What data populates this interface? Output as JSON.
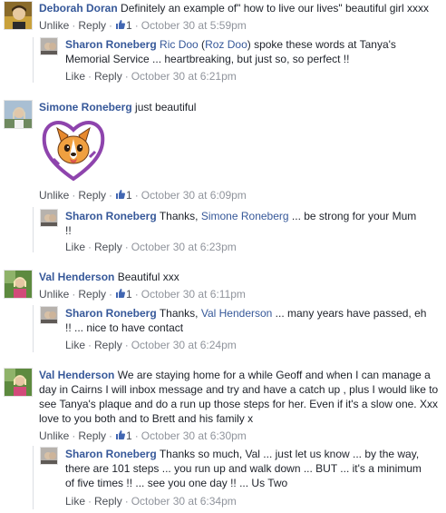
{
  "colors": {
    "link": "#365899",
    "meta": "#90949c",
    "text": "#1d2129",
    "action": "#4b4f56"
  },
  "comments": [
    {
      "author": "Deborah Doran",
      "text": "Definitely an example of\" how to live our lives\" beautiful girl xxxx",
      "unlike": "Unlike",
      "reply": "Reply",
      "likes": "1",
      "time": "October 30 at 5:59pm",
      "reply_item": {
        "author": "Sharon Roneberg",
        "mention1": "Ric Doo",
        "paren_open": " (",
        "mention2": "Roz Doo",
        "text": ") spoke these words at Tanya's Memorial Service ... heartbreaking, but just so, so perfect !!",
        "like": "Like",
        "reply": "Reply",
        "time": "October 30 at 6:21pm"
      }
    },
    {
      "author": "Simone Roneberg",
      "text": "just beautiful",
      "sticker": "corgi-heart-sticker",
      "unlike": "Unlike",
      "reply": "Reply",
      "likes": "1",
      "time": "October 30 at 6:09pm",
      "reply_item": {
        "author": "Sharon Roneberg",
        "pre": "Thanks, ",
        "mention": "Simone Roneberg",
        "text": " ... be strong for your Mum !!",
        "like": "Like",
        "reply": "Reply",
        "time": "October 30 at 6:23pm"
      }
    },
    {
      "author": "Val Henderson",
      "text": "Beautiful xxx",
      "unlike": "Unlike",
      "reply": "Reply",
      "likes": "1",
      "time": "October 30 at 6:11pm",
      "reply_item": {
        "author": "Sharon Roneberg",
        "pre": "Thanks, ",
        "mention": "Val Henderson",
        "text": " ... many years have passed, eh !! ... nice to have contact",
        "like": "Like",
        "reply": "Reply",
        "time": "October 30 at 6:24pm"
      }
    },
    {
      "author": "Val Henderson",
      "text": "We are staying home for a while Geoff and when I can manage a day in Cairns I will inbox message and try and have a catch up , plus I would like to see Tanya's plaque and do a run up those steps for her. Even if it's a slow one. Xxx love to you both and to Brett and his family x",
      "unlike": "Unlike",
      "reply": "Reply",
      "likes": "1",
      "time": "October 30 at 6:30pm",
      "reply_item": {
        "author": "Sharon Roneberg",
        "text": "Thanks so much, Val ... just let us know ... by the way, there are 101 steps ... you run up and walk down ... BUT ... it's a minimum of five times !! ... see you one day !! ... Us Two",
        "like": "Like",
        "reply": "Reply",
        "time": "October 30 at 6:34pm"
      }
    }
  ]
}
